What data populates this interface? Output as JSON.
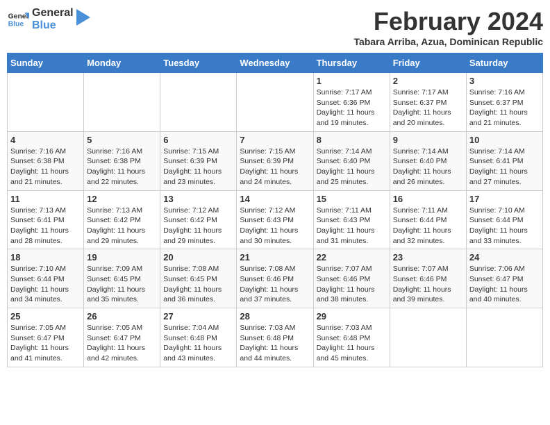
{
  "header": {
    "logo_general": "General",
    "logo_blue": "Blue",
    "title": "February 2024",
    "subtitle": "Tabara Arriba, Azua, Dominican Republic"
  },
  "weekdays": [
    "Sunday",
    "Monday",
    "Tuesday",
    "Wednesday",
    "Thursday",
    "Friday",
    "Saturday"
  ],
  "weeks": [
    [
      {
        "day": "",
        "info": ""
      },
      {
        "day": "",
        "info": ""
      },
      {
        "day": "",
        "info": ""
      },
      {
        "day": "",
        "info": ""
      },
      {
        "day": "1",
        "info": "Sunrise: 7:17 AM\nSunset: 6:36 PM\nDaylight: 11 hours and 19 minutes."
      },
      {
        "day": "2",
        "info": "Sunrise: 7:17 AM\nSunset: 6:37 PM\nDaylight: 11 hours and 20 minutes."
      },
      {
        "day": "3",
        "info": "Sunrise: 7:16 AM\nSunset: 6:37 PM\nDaylight: 11 hours and 21 minutes."
      }
    ],
    [
      {
        "day": "4",
        "info": "Sunrise: 7:16 AM\nSunset: 6:38 PM\nDaylight: 11 hours and 21 minutes."
      },
      {
        "day": "5",
        "info": "Sunrise: 7:16 AM\nSunset: 6:38 PM\nDaylight: 11 hours and 22 minutes."
      },
      {
        "day": "6",
        "info": "Sunrise: 7:15 AM\nSunset: 6:39 PM\nDaylight: 11 hours and 23 minutes."
      },
      {
        "day": "7",
        "info": "Sunrise: 7:15 AM\nSunset: 6:39 PM\nDaylight: 11 hours and 24 minutes."
      },
      {
        "day": "8",
        "info": "Sunrise: 7:14 AM\nSunset: 6:40 PM\nDaylight: 11 hours and 25 minutes."
      },
      {
        "day": "9",
        "info": "Sunrise: 7:14 AM\nSunset: 6:40 PM\nDaylight: 11 hours and 26 minutes."
      },
      {
        "day": "10",
        "info": "Sunrise: 7:14 AM\nSunset: 6:41 PM\nDaylight: 11 hours and 27 minutes."
      }
    ],
    [
      {
        "day": "11",
        "info": "Sunrise: 7:13 AM\nSunset: 6:41 PM\nDaylight: 11 hours and 28 minutes."
      },
      {
        "day": "12",
        "info": "Sunrise: 7:13 AM\nSunset: 6:42 PM\nDaylight: 11 hours and 29 minutes."
      },
      {
        "day": "13",
        "info": "Sunrise: 7:12 AM\nSunset: 6:42 PM\nDaylight: 11 hours and 29 minutes."
      },
      {
        "day": "14",
        "info": "Sunrise: 7:12 AM\nSunset: 6:43 PM\nDaylight: 11 hours and 30 minutes."
      },
      {
        "day": "15",
        "info": "Sunrise: 7:11 AM\nSunset: 6:43 PM\nDaylight: 11 hours and 31 minutes."
      },
      {
        "day": "16",
        "info": "Sunrise: 7:11 AM\nSunset: 6:44 PM\nDaylight: 11 hours and 32 minutes."
      },
      {
        "day": "17",
        "info": "Sunrise: 7:10 AM\nSunset: 6:44 PM\nDaylight: 11 hours and 33 minutes."
      }
    ],
    [
      {
        "day": "18",
        "info": "Sunrise: 7:10 AM\nSunset: 6:44 PM\nDaylight: 11 hours and 34 minutes."
      },
      {
        "day": "19",
        "info": "Sunrise: 7:09 AM\nSunset: 6:45 PM\nDaylight: 11 hours and 35 minutes."
      },
      {
        "day": "20",
        "info": "Sunrise: 7:08 AM\nSunset: 6:45 PM\nDaylight: 11 hours and 36 minutes."
      },
      {
        "day": "21",
        "info": "Sunrise: 7:08 AM\nSunset: 6:46 PM\nDaylight: 11 hours and 37 minutes."
      },
      {
        "day": "22",
        "info": "Sunrise: 7:07 AM\nSunset: 6:46 PM\nDaylight: 11 hours and 38 minutes."
      },
      {
        "day": "23",
        "info": "Sunrise: 7:07 AM\nSunset: 6:46 PM\nDaylight: 11 hours and 39 minutes."
      },
      {
        "day": "24",
        "info": "Sunrise: 7:06 AM\nSunset: 6:47 PM\nDaylight: 11 hours and 40 minutes."
      }
    ],
    [
      {
        "day": "25",
        "info": "Sunrise: 7:05 AM\nSunset: 6:47 PM\nDaylight: 11 hours and 41 minutes."
      },
      {
        "day": "26",
        "info": "Sunrise: 7:05 AM\nSunset: 6:47 PM\nDaylight: 11 hours and 42 minutes."
      },
      {
        "day": "27",
        "info": "Sunrise: 7:04 AM\nSunset: 6:48 PM\nDaylight: 11 hours and 43 minutes."
      },
      {
        "day": "28",
        "info": "Sunrise: 7:03 AM\nSunset: 6:48 PM\nDaylight: 11 hours and 44 minutes."
      },
      {
        "day": "29",
        "info": "Sunrise: 7:03 AM\nSunset: 6:48 PM\nDaylight: 11 hours and 45 minutes."
      },
      {
        "day": "",
        "info": ""
      },
      {
        "day": "",
        "info": ""
      }
    ]
  ]
}
